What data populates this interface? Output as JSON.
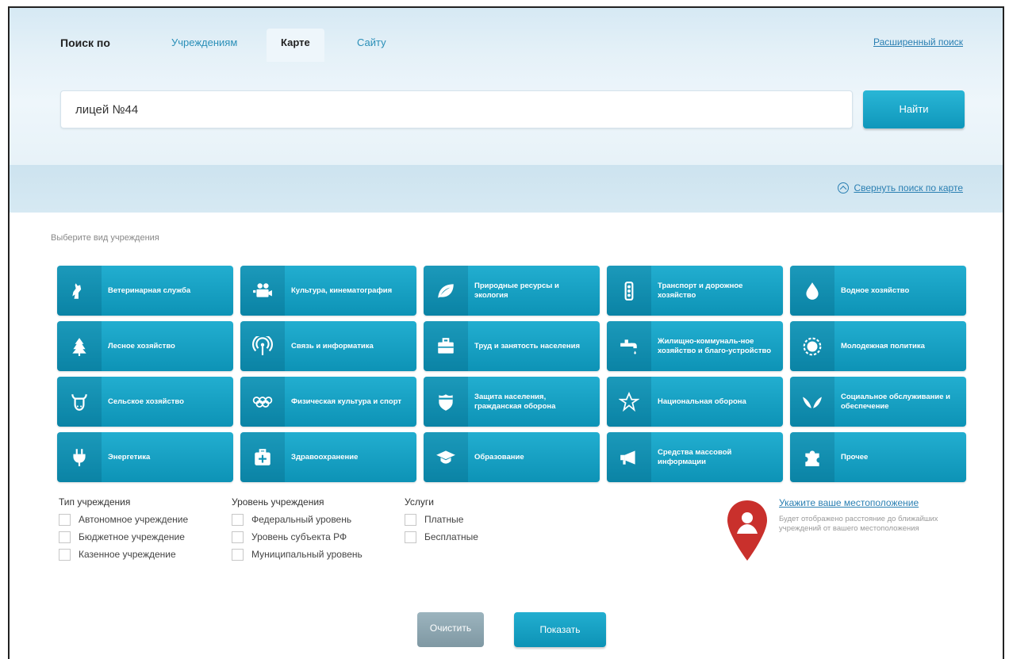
{
  "search": {
    "prefix_label": "Поиск по",
    "tabs": [
      {
        "label": "Учреждениям",
        "active": false
      },
      {
        "label": "Карте",
        "active": true
      },
      {
        "label": "Сайту",
        "active": false
      }
    ],
    "advanced_link": "Расширенный поиск",
    "query_value": "лицей №44",
    "search_button": "Найти",
    "collapse_link": "Свернуть поиск по карте"
  },
  "categories_label": "Выберите вид учреждения",
  "categories": [
    {
      "label": "Ветеринарная служба",
      "icon": "dog-icon"
    },
    {
      "label": "Культура, кинематография",
      "icon": "film-camera-icon"
    },
    {
      "label": "Природные ресурсы и экология",
      "icon": "leaf-icon"
    },
    {
      "label": "Транспорт и дорожное хозяйство",
      "icon": "traffic-light-icon"
    },
    {
      "label": "Водное хозяйство",
      "icon": "water-drop-icon"
    },
    {
      "label": "Лесное хозяйство",
      "icon": "tree-icon"
    },
    {
      "label": "Связь и информатика",
      "icon": "antenna-icon"
    },
    {
      "label": "Труд и занятость населения",
      "icon": "briefcase-icon"
    },
    {
      "label": "Жилищно-коммуналь-ное хозяйство и благо-устройство",
      "icon": "faucet-icon"
    },
    {
      "label": "Молодежная политика",
      "icon": "sun-icon"
    },
    {
      "label": "Сельское хозяйство",
      "icon": "cow-icon"
    },
    {
      "label": "Физическая культура и спорт",
      "icon": "olympic-rings-icon"
    },
    {
      "label": "Защита населения, гражданская оборона",
      "icon": "shield-icon"
    },
    {
      "label": "Национальная оборона",
      "icon": "star-icon"
    },
    {
      "label": "Социальное обслуживание и обеспечение",
      "icon": "wings-icon"
    },
    {
      "label": "Энергетика",
      "icon": "plug-icon"
    },
    {
      "label": "Здравоохранение",
      "icon": "first-aid-icon"
    },
    {
      "label": "Образование",
      "icon": "graduation-cap-icon"
    },
    {
      "label": "Средства массовой информации",
      "icon": "megaphone-icon"
    },
    {
      "label": "Прочее",
      "icon": "puzzle-icon"
    }
  ],
  "filters": {
    "type": {
      "title": "Тип учреждения",
      "options": [
        "Автономное учреждение",
        "Бюджетное учреждение",
        "Казенное учреждение"
      ]
    },
    "level": {
      "title": "Уровень учреждения",
      "options": [
        "Федеральный уровень",
        "Уровень субъекта РФ",
        "Муниципальный уровень"
      ]
    },
    "services": {
      "title": "Услуги",
      "options": [
        "Платные",
        "Бесплатные"
      ]
    }
  },
  "location": {
    "link": "Укажите ваше местоположение",
    "description": "Будет отображено расстояние до ближайших учреждений от вашего местоположения"
  },
  "actions": {
    "clear": "Очистить",
    "show": "Показать"
  },
  "colors": {
    "accent": "#0f97bb",
    "link": "#2a7fb2",
    "pin": "#c9302c"
  }
}
